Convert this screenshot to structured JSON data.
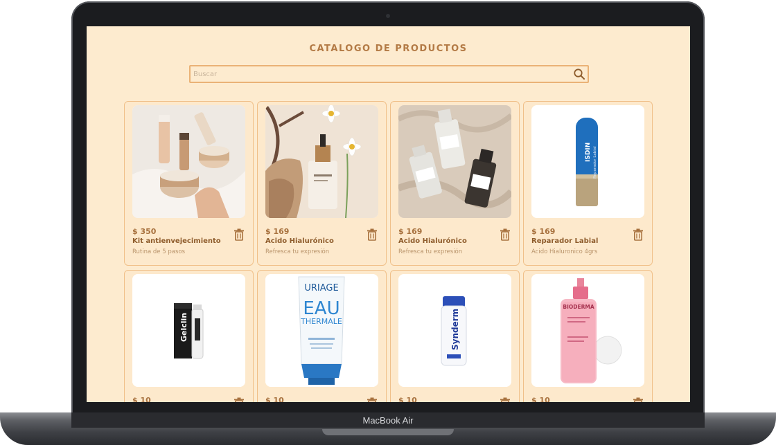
{
  "device": {
    "label": "MacBook Air"
  },
  "header": {
    "title": "CATALOGO DE PRODUCTOS"
  },
  "search": {
    "placeholder": "Buscar",
    "value": ""
  },
  "products": [
    {
      "price": "$ 350",
      "name": "Kit antienvejecimiento",
      "description": "Rutina de 5 pasos",
      "image": "skincare-kit-photo"
    },
    {
      "price": "$ 169",
      "name": "Acido Hialurónico",
      "description": "Refresca tu expresión",
      "image": "serum-dropper-photo"
    },
    {
      "price": "$ 169",
      "name": "Acido Hialurónico",
      "description": "Refresca tu expresión",
      "image": "serum-bottles-photo"
    },
    {
      "price": "$ 169",
      "name": "Reparador Labial",
      "description": "Acido Hialuronico 4grs",
      "image": "lip-balm-photo"
    },
    {
      "price": "$ 10",
      "name": "",
      "description": "",
      "image": "gelclin-photo"
    },
    {
      "price": "$ 10",
      "name": "",
      "description": "",
      "image": "uriage-cream-photo"
    },
    {
      "price": "$ 10",
      "name": "",
      "description": "",
      "image": "synderm-bottle-photo"
    },
    {
      "price": "$ 10",
      "name": "",
      "description": "",
      "image": "bioderma-bottle-photo"
    }
  ],
  "product_labels": {
    "isdin": "ISDIN",
    "reparador": "Reparador Labial",
    "gelclin": "Gelclin",
    "uriage_brand": "URIAGE",
    "uriage_line1": "EAU",
    "uriage_line2": "THERMALE",
    "synderm": "Synderm",
    "bioderma": "BIODERMA"
  },
  "colors": {
    "background": "#fdebcf",
    "accent": "#eab276",
    "title": "#b37a45",
    "price": "#a8723f"
  },
  "icons": {
    "search": "search-icon",
    "delete": "trash-icon"
  }
}
